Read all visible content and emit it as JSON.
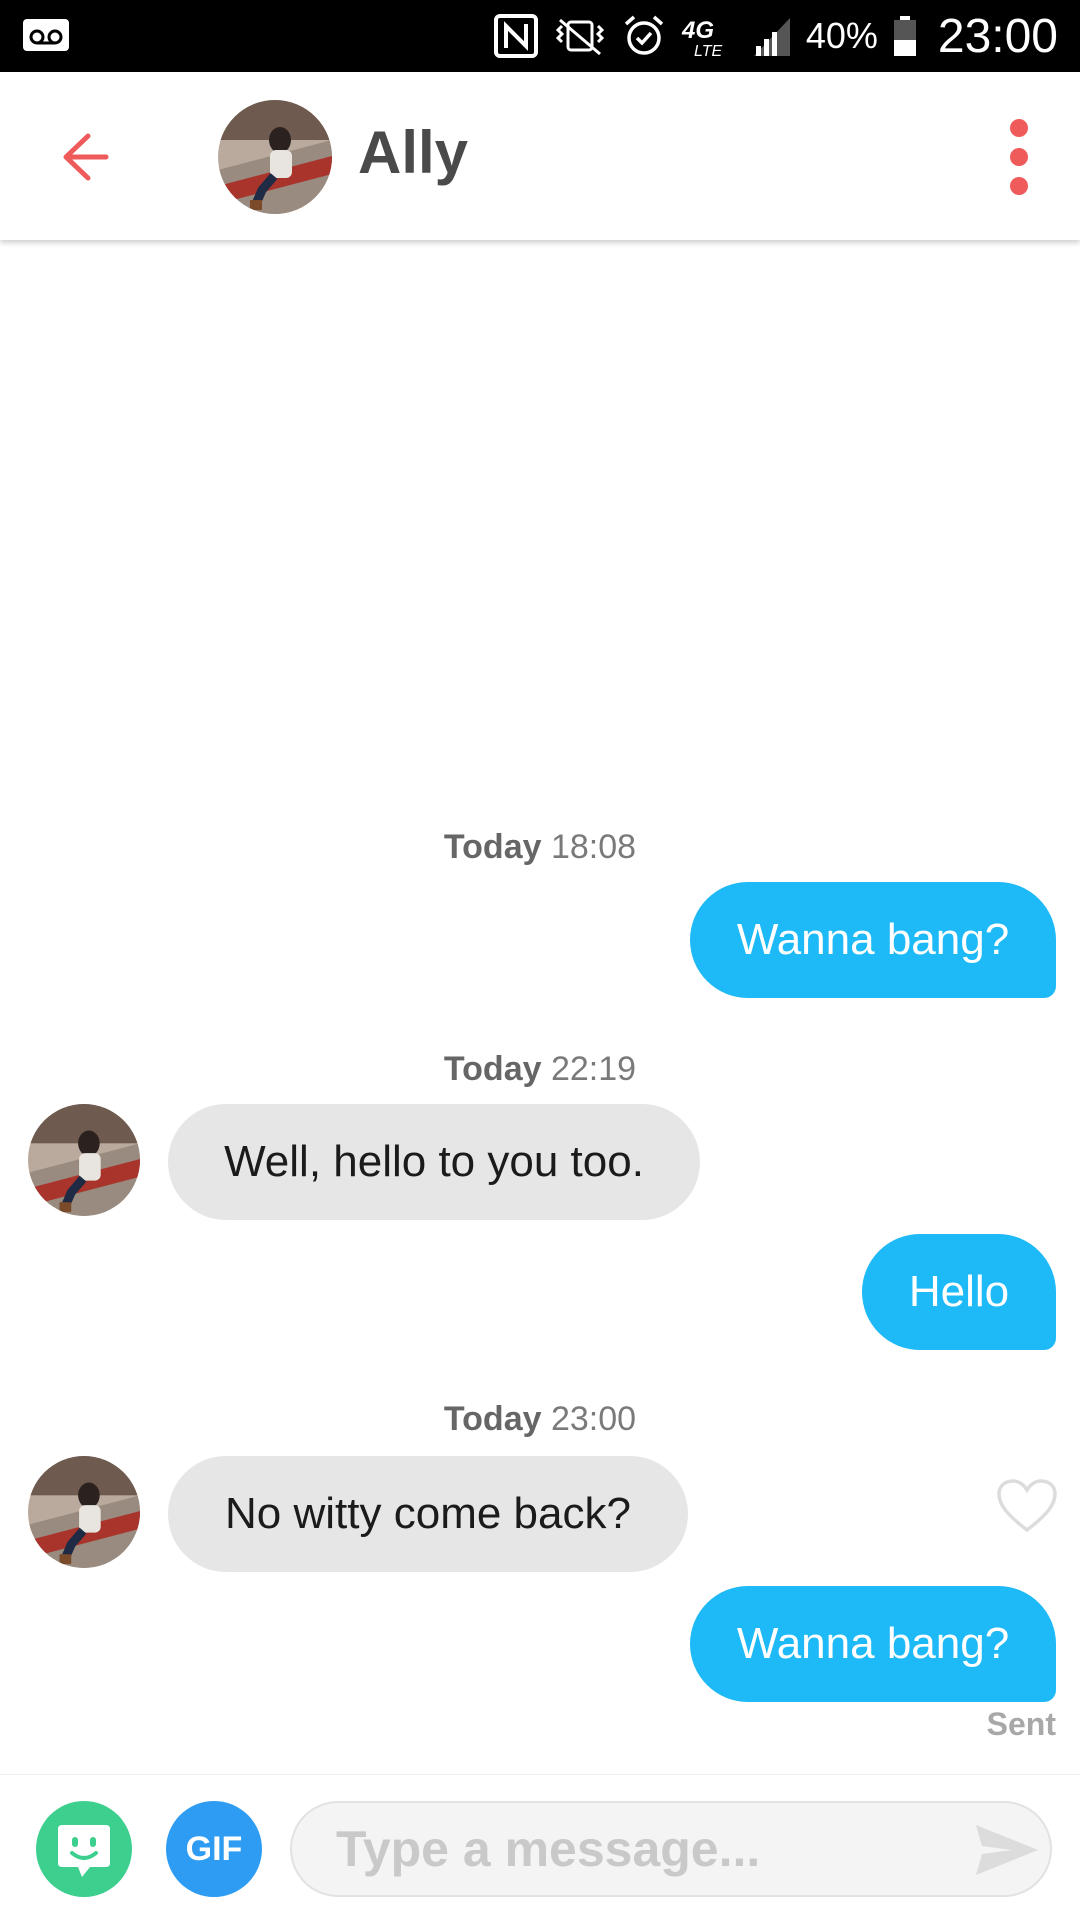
{
  "status_bar": {
    "battery": "40%",
    "time": "23:00",
    "network": "4G LTE",
    "icons": [
      "voicemail-icon",
      "nfc-icon",
      "vibrate-icon",
      "alarm-icon",
      "network-4g-lte-icon",
      "signal-icon",
      "battery-icon"
    ]
  },
  "header": {
    "contact_name": "Ally",
    "back_icon": "arrow-left-icon",
    "menu_icon": "more-vertical-icon",
    "accent_color": "#ef5a5a"
  },
  "messages": [
    {
      "timestamp_day": "Today",
      "timestamp_time": "18:08"
    },
    {
      "direction": "out",
      "text": "Wanna bang?"
    },
    {
      "timestamp_day": "Today",
      "timestamp_time": "22:19"
    },
    {
      "direction": "in",
      "text": "Well, hello to you too."
    },
    {
      "direction": "out",
      "text": "Hello"
    },
    {
      "timestamp_day": "Today",
      "timestamp_time": "23:00"
    },
    {
      "direction": "in",
      "text": "No witty come back?"
    },
    {
      "direction": "out",
      "text": "Wanna bang?"
    }
  ],
  "sent_label": "Sent",
  "colors": {
    "outgoing_bubble": "#1eb9f7",
    "incoming_bubble": "#e6e6e6",
    "sticker_button": "#3ccf8e",
    "gif_button": "#2d9cf2"
  },
  "composer": {
    "gif_label": "GIF",
    "placeholder": "Type a message...",
    "value": ""
  }
}
